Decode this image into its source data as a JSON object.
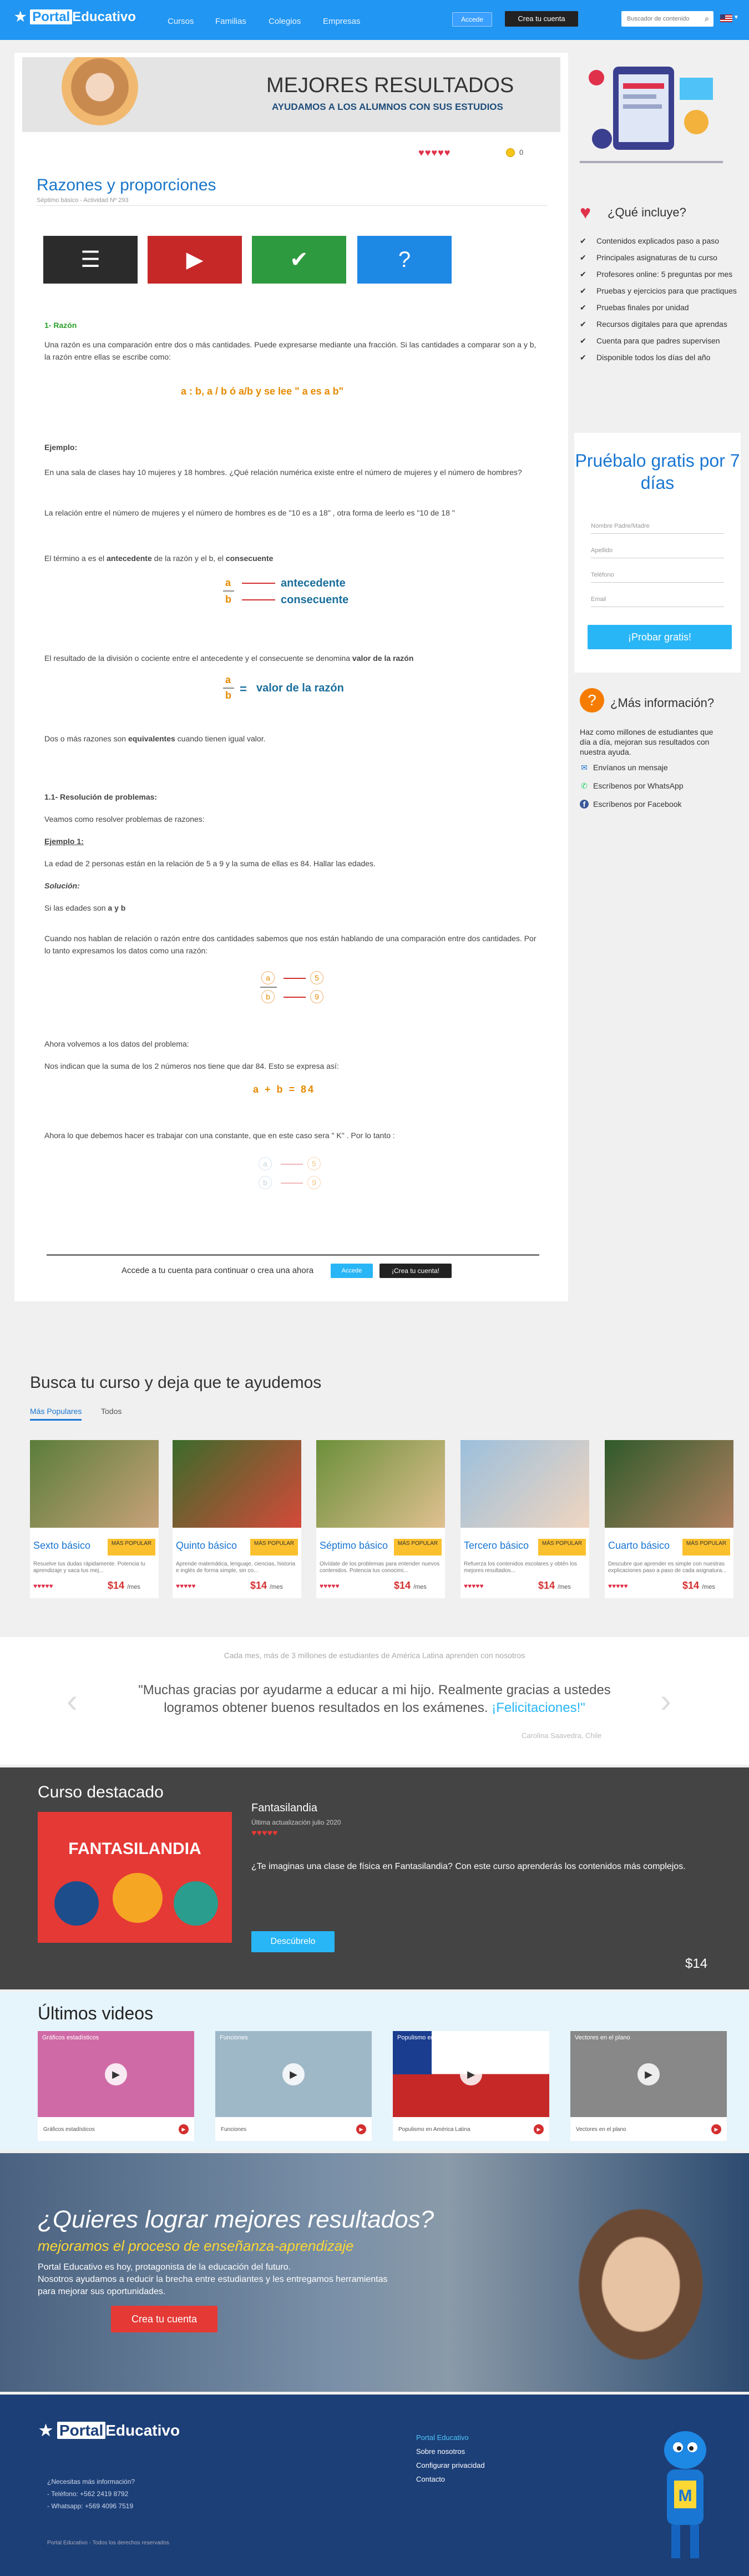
{
  "header": {
    "logo_a": "Portal",
    "logo_b": "Educativo",
    "nav": [
      "Cursos",
      "Familias",
      "Colegios",
      "Empresas"
    ],
    "login": "Accede",
    "create": "Crea tu cuenta",
    "search_placeholder": "Buscador de contenido",
    "lang": "▼"
  },
  "banner": {
    "line1": "MEJORES RESULTADOS",
    "line2": "AYUDAMOS A LOS ALUMNOS CON SUS ESTUDIOS"
  },
  "lesson": {
    "hearts": "♥♥♥♥♥",
    "coins": "0",
    "title": "Razones y proporciones",
    "subtitle": "Séptimo básico - Actividad Nº 293",
    "tiles": [
      {
        "icon": "list-icon",
        "color": "#2b2b2b",
        "glyph": "☰"
      },
      {
        "icon": "play-icon",
        "color": "#c62828",
        "glyph": "▶"
      },
      {
        "icon": "check-icon",
        "color": "#2e9a3f",
        "glyph": "✔"
      },
      {
        "icon": "question-icon",
        "color": "#1e88e5",
        "glyph": "?"
      }
    ],
    "s1": "1- Razón",
    "p1": "Una razón es una comparación entre dos o más cantidades. Puede expresarse mediante una fracción. Si las cantidades a comparar son  a y b, la razón entre ellas se escribe como:",
    "f1": "a : b, a / b  ó   a/b  y se lee \" a es a b\"",
    "ej": "Ejemplo:",
    "p2": "En una sala de clases hay 10 mujeres y 18 hombres. ¿Qué relación numérica existe entre el número de mujeres y el número de hombres?",
    "p3": "La relación entre el número de mujeres y el número de hombres es de  \"10 es a 18\" , otra forma de leerlo es \"10 de 18 \"",
    "p4a": "El término a es el ",
    "p4b": "antecedente",
    "p4c": " de la razón y el b, el ",
    "p4d": "consecuente",
    "ant": "antecedente",
    "con": "consecuente",
    "p5a": "El resultado de la división o cociente entre el antecedente y el consecuente se denomina ",
    "p5b": "valor de la razón",
    "vr": "valor de la razón",
    "p6a": "Dos o más razones son ",
    "p6b": "equivalentes",
    "p6c": " cuando tienen igual valor.",
    "s11": "1.1- Resolución de problemas:",
    "p7": "Veamos como resolver problemas de razones:",
    "ej1": "Ejemplo 1:",
    "p8": "La edad de 2 personas están en la relación de 5 a 9 y la suma de ellas es 84. Hallar las edades.",
    "sol": "Solución:",
    "p9a": "Si las edades son ",
    "p9b": "a y b",
    "p10": "Cuando nos hablan de relación o razón entre dos cantidades sabemos que nos están hablando de una comparación entre dos cantidades. Por lo tanto expresamos los datos como una razón:",
    "p11": "Ahora volvemos a los datos del problema:",
    "p12": "Nos indican que la suma de los 2 números nos tiene que dar 84. Esto se expresa así:",
    "f2": "a + b = 84",
    "p13": "Ahora lo que debemos hacer es trabajar con una constante, que en este caso sera \" K\" . Por lo tanto :",
    "prompt": "Accede a tu cuenta para continuar o crea una ahora",
    "prompt_login": "Accede",
    "prompt_create": "¡Crea tu cuenta!"
  },
  "sidebar": {
    "includes_title": "¿Qué incluye?",
    "includes": [
      "Contenidos explicados paso a paso",
      "Principales asignaturas de tu curso",
      "Profesores online: 5 preguntas por mes",
      "Pruebas y ejercicios para que practiques",
      "Pruebas finales por unidad",
      "Recursos digitales para que aprendas",
      "Cuenta para que padres supervisen",
      "Disponible todos los días del año"
    ],
    "try_title": "Pruébalo gratis por 7 días",
    "fields": [
      "Nombre Padre/Madre",
      "Apellido",
      "Teléfono",
      "Email"
    ],
    "try_btn": "¡Probar gratis!",
    "more_title": "¿Más información?",
    "more_text": "Haz como millones de estudiantes que día a día, mejoran sus resultados con nuestra ayuda.",
    "contacts": [
      "Envíanos un mensaje",
      "Escríbenos por WhatsApp",
      "Escríbenos por Facebook"
    ]
  },
  "courses": {
    "title": "Busca tu curso y deja que te ayudemos",
    "tabs": [
      "Más Populares",
      "Todos"
    ],
    "items": [
      {
        "name": "Sexto básico",
        "badge": "MÁS POPULAR",
        "desc": "Resuelve tus dudas rápidamente. Potencia tu aprendizaje y saca tus mej...",
        "hearts": "♥♥♥♥♥",
        "price": "$14",
        "per": "/mes",
        "c1": "#5a7d3a",
        "c2": "#c8a27a"
      },
      {
        "name": "Quinto básico",
        "badge": "MÁS POPULAR",
        "desc": "Aprende matemática, lenguaje, ciencias, historia e inglés de forma simple, sin co...",
        "hearts": "♥♥♥♥♥",
        "price": "$14",
        "per": "/mes",
        "c1": "#3b6b2a",
        "c2": "#d44a3a"
      },
      {
        "name": "Séptimo básico",
        "badge": "MÁS POPULAR",
        "desc": "Olvídate de los problemas para entender nuevos contenidos. Potencia tus conocimi...",
        "hearts": "♥♥♥♥♥",
        "price": "$14",
        "per": "/mes",
        "c1": "#6b8f3a",
        "c2": "#e0c090"
      },
      {
        "name": "Tercero básico",
        "badge": "MÁS POPULAR",
        "desc": "Refuerza los contenidos escolares y obtén los mejores resultados...",
        "hearts": "♥♥♥♥♥",
        "price": "$14",
        "per": "/mes",
        "c1": "#9bbfdc",
        "c2": "#f0d5c0"
      },
      {
        "name": "Cuarto básico",
        "badge": "MÁS POPULAR",
        "desc": "Descubre que aprender es simple con nuestras explicaciones paso a paso de cada asignatura...",
        "hearts": "♥♥♥♥♥",
        "price": "$14",
        "per": "/mes",
        "c1": "#2f5a2a",
        "c2": "#b08060"
      }
    ]
  },
  "testimonial": {
    "caption": "Cada mes, más de 3 millones de estudiantes de América Latina aprenden con nosotros",
    "quote": "\"Muchas gracias por ayudarme a educar a mi hijo. Realmente gracias a ustedes logramos obtener buenos resultados en los exámenes. ",
    "quote_hl": "¡Felicitaciones!\"",
    "author": "Carolina Saavedra, Chile"
  },
  "featured": {
    "title": "Curso destacado",
    "img_title": "FANTASILANDIA",
    "name": "Fantasilandia",
    "updated": "Última actualización julio 2020",
    "hearts": "♥♥♥♥♥",
    "desc": "¿Te imaginas una clase de física en Fantasilandia? Con este curso aprenderás los contenidos más complejos.",
    "btn": "Descúbrelo",
    "price": "$14"
  },
  "videos": {
    "title": "Últimos videos",
    "items": [
      {
        "label": "Gráficos estadísticos",
        "cap": "Gráficos estadísticos",
        "c": "#d06aa6"
      },
      {
        "label": "Funciones",
        "cap": "Funciones",
        "c": "#9fb8c8"
      },
      {
        "label": "Populismo en América Latina",
        "cap": "Populismo en América Latina",
        "c": "#c62828"
      },
      {
        "label": "Vectores en el plano",
        "cap": "Vectores en el plano",
        "c": "#888888"
      }
    ]
  },
  "cta": {
    "title": "¿Quieres lograr mejores resultados?",
    "subtitle": "mejoramos el proceso de enseñanza-aprendizaje",
    "p1": "Portal Educativo es hoy, protagonista de la educación del futuro.",
    "p2": "Nosotros ayudamos a reducir la brecha entre estudiantes y les entregamos herramientas para mejorar sus oportunidades.",
    "btn": "Crea tu cuenta"
  },
  "footer": {
    "need": "¿Necesitas más información?",
    "tel": "- Teléfono: +562 2419 8792",
    "wa": "- Whatsapp: +569 4096 7519",
    "links": [
      "Portal Educativo",
      "Sobre nosotros",
      "Configurar privacidad",
      "Contacto"
    ],
    "copy": "Portal Educativo - Todos los derechos reservados"
  }
}
